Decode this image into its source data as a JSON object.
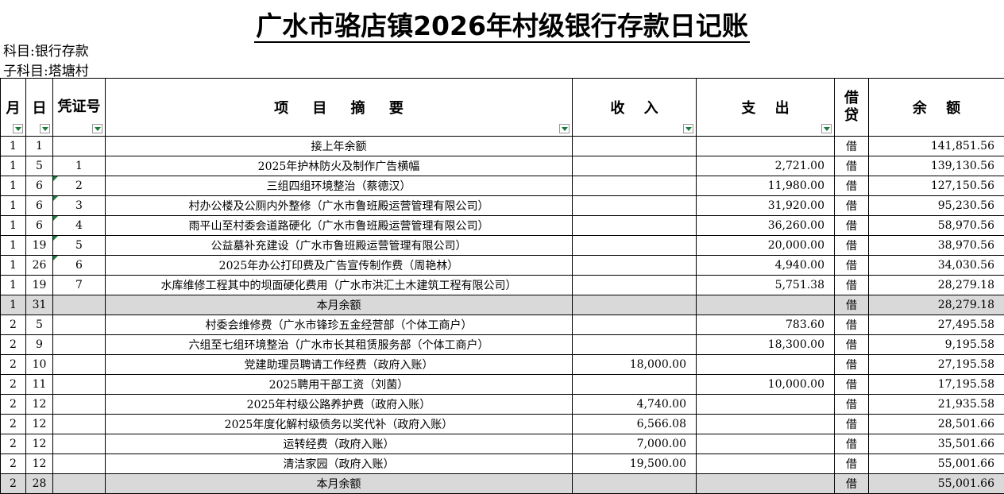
{
  "title": "广水市骆店镇2026年村级银行存款日记账",
  "subject": "科目:银行存款",
  "sub_subject": "子科目:塔塘村__",
  "headers": {
    "month": "月",
    "day": "日",
    "voucher": "凭证号",
    "summary": "项 目 摘 要",
    "income": "收 入",
    "expense": "支 出",
    "dc": "借贷",
    "balance": "余 额"
  },
  "rows": [
    {
      "month": "1",
      "day": "1",
      "voucher": "",
      "summary": "接上年余额",
      "income": "",
      "expense": "",
      "dc": "借",
      "balance": "141,851.56",
      "is_summary": false
    },
    {
      "month": "1",
      "day": "5",
      "voucher": "1",
      "summary": "2025年护林防火及制作广告横幅",
      "income": "",
      "expense": "2,721.00",
      "dc": "借",
      "balance": "139,130.56",
      "is_summary": false
    },
    {
      "month": "1",
      "day": "6",
      "voucher": "2",
      "summary": "三组四组环境整治（蔡德汉）",
      "income": "",
      "expense": "11,980.00",
      "dc": "借",
      "balance": "127,150.56",
      "is_summary": false
    },
    {
      "month": "1",
      "day": "6",
      "voucher": "3",
      "summary": "村办公楼及公厕内外整修（广水市鲁班殿运营管理有限公司）",
      "income": "",
      "expense": "31,920.00",
      "dc": "借",
      "balance": "95,230.56",
      "is_summary": false
    },
    {
      "month": "1",
      "day": "6",
      "voucher": "4",
      "summary": "雨平山至村委会道路硬化（广水市鲁班殿运营管理有限公司）",
      "income": "",
      "expense": "36,260.00",
      "dc": "借",
      "balance": "58,970.56",
      "is_summary": false
    },
    {
      "month": "1",
      "day": "19",
      "voucher": "5",
      "summary": "公益墓补充建设（广水市鲁班殿运营管理有限公司）",
      "income": "",
      "expense": "20,000.00",
      "dc": "借",
      "balance": "38,970.56",
      "is_summary": false
    },
    {
      "month": "1",
      "day": "26",
      "voucher": "6",
      "summary": "2025年办公打印费及广告宣传制作费（周艳林）",
      "income": "",
      "expense": "4,940.00",
      "dc": "借",
      "balance": "34,030.56",
      "is_summary": false
    },
    {
      "month": "1",
      "day": "19",
      "voucher": "7",
      "summary": "水库维修工程其中的坝面硬化费用（广水市洪汇土木建筑工程有限公司）",
      "income": "",
      "expense": "5,751.38",
      "dc": "借",
      "balance": "28,279.18",
      "is_summary": false
    },
    {
      "month": "1",
      "day": "31",
      "voucher": "",
      "summary": "本月余额",
      "income": "",
      "expense": "",
      "dc": "借",
      "balance": "28,279.18",
      "is_summary": true
    },
    {
      "month": "2",
      "day": "5",
      "voucher": "",
      "summary": "村委会维修费（广水市锋珍五金经营部（个体工商户）",
      "income": "",
      "expense": "783.60",
      "dc": "借",
      "balance": "27,495.58",
      "is_summary": false
    },
    {
      "month": "2",
      "day": "9",
      "voucher": "",
      "summary": "六组至七组环境整治（广水市长其租赁服务部（个体工商户）",
      "income": "",
      "expense": "18,300.00",
      "dc": "借",
      "balance": "9,195.58",
      "is_summary": false
    },
    {
      "month": "2",
      "day": "10",
      "voucher": "",
      "summary": "党建助理员聘请工作经费（政府入账）",
      "income": "18,000.00",
      "expense": "",
      "dc": "借",
      "balance": "27,195.58",
      "is_summary": false
    },
    {
      "month": "2",
      "day": "11",
      "voucher": "",
      "summary": "2025聘用干部工资（刘菌）",
      "income": "",
      "expense": "10,000.00",
      "dc": "借",
      "balance": "17,195.58",
      "is_summary": false
    },
    {
      "month": "2",
      "day": "12",
      "voucher": "",
      "summary": "2025年村级公路养护费（政府入账）",
      "income": "4,740.00",
      "expense": "",
      "dc": "借",
      "balance": "21,935.58",
      "is_summary": false
    },
    {
      "month": "2",
      "day": "12",
      "voucher": "",
      "summary": "2025年度化解村级债务以奖代补（政府入账）",
      "income": "6,566.08",
      "expense": "",
      "dc": "借",
      "balance": "28,501.66",
      "is_summary": false
    },
    {
      "month": "2",
      "day": "12",
      "voucher": "",
      "summary": "运转经费（政府入账）",
      "income": "7,000.00",
      "expense": "",
      "dc": "借",
      "balance": "35,501.66",
      "is_summary": false
    },
    {
      "month": "2",
      "day": "12",
      "voucher": "",
      "summary": "清洁家园（政府入账）",
      "income": "19,500.00",
      "expense": "",
      "dc": "借",
      "balance": "55,001.66",
      "is_summary": false
    },
    {
      "month": "2",
      "day": "28",
      "voucher": "",
      "summary": "本月余额",
      "income": "",
      "expense": "",
      "dc": "借",
      "balance": "55,001.66",
      "is_summary": true
    }
  ]
}
